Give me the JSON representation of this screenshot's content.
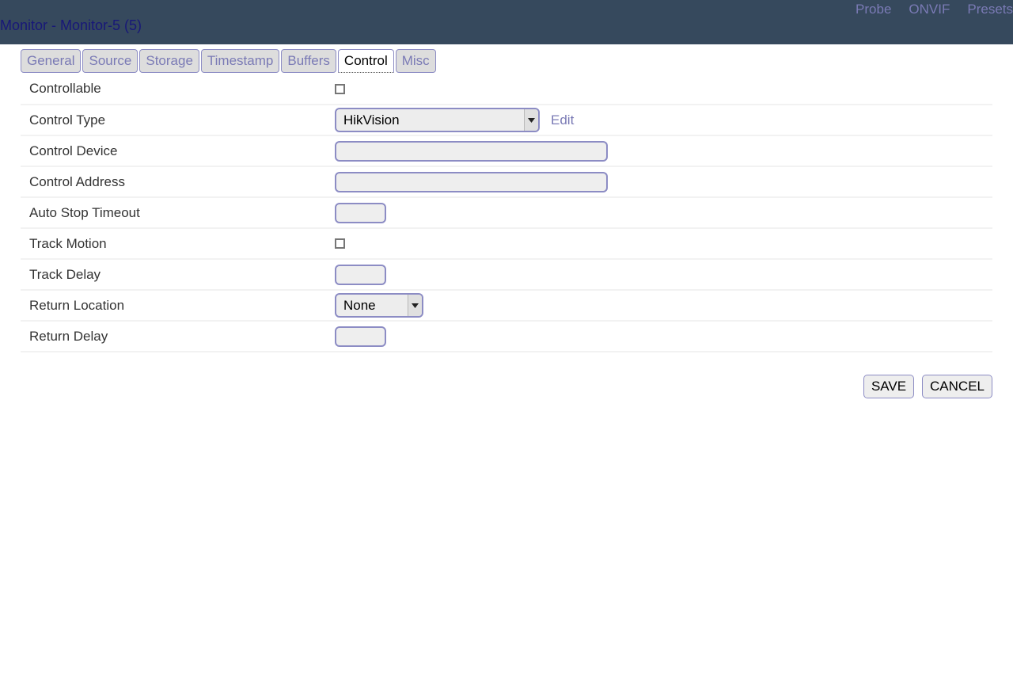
{
  "header": {
    "title": "Monitor - Monitor-5 (5)",
    "nav": [
      {
        "label": "Probe",
        "name": "probe"
      },
      {
        "label": "ONVIF",
        "name": "onvif"
      },
      {
        "label": "Presets",
        "name": "presets"
      }
    ],
    "bar_color": "#36495d",
    "title_color": "#181878",
    "nav_color": "#7a7ab5"
  },
  "tabs": [
    {
      "label": "General",
      "active": false
    },
    {
      "label": "Source",
      "active": false
    },
    {
      "label": "Storage",
      "active": false
    },
    {
      "label": "Timestamp",
      "active": false
    },
    {
      "label": "Buffers",
      "active": false
    },
    {
      "label": "Control",
      "active": true
    },
    {
      "label": "Misc",
      "active": false
    }
  ],
  "form": {
    "controllable": {
      "label": "Controllable",
      "checked": false
    },
    "control_type": {
      "label": "Control Type",
      "value": "HikVision",
      "options": [
        "HikVision"
      ],
      "edit_label": "Edit"
    },
    "control_device": {
      "label": "Control Device",
      "value": "",
      "placeholder": ""
    },
    "control_address": {
      "label": "Control Address",
      "value": "",
      "placeholder": ""
    },
    "auto_stop_timeout": {
      "label": "Auto Stop Timeout",
      "value": "",
      "placeholder": ""
    },
    "track_motion": {
      "label": "Track Motion",
      "checked": false
    },
    "track_delay": {
      "label": "Track Delay",
      "value": "",
      "placeholder": ""
    },
    "return_location": {
      "label": "Return Location",
      "value": "None",
      "options": [
        "None"
      ]
    },
    "return_delay": {
      "label": "Return Delay",
      "value": "",
      "placeholder": ""
    }
  },
  "actions": {
    "save_label": "SAVE",
    "cancel_label": "CANCEL"
  },
  "icons": {
    "dropdown_arrow": "chevron-down-icon"
  }
}
